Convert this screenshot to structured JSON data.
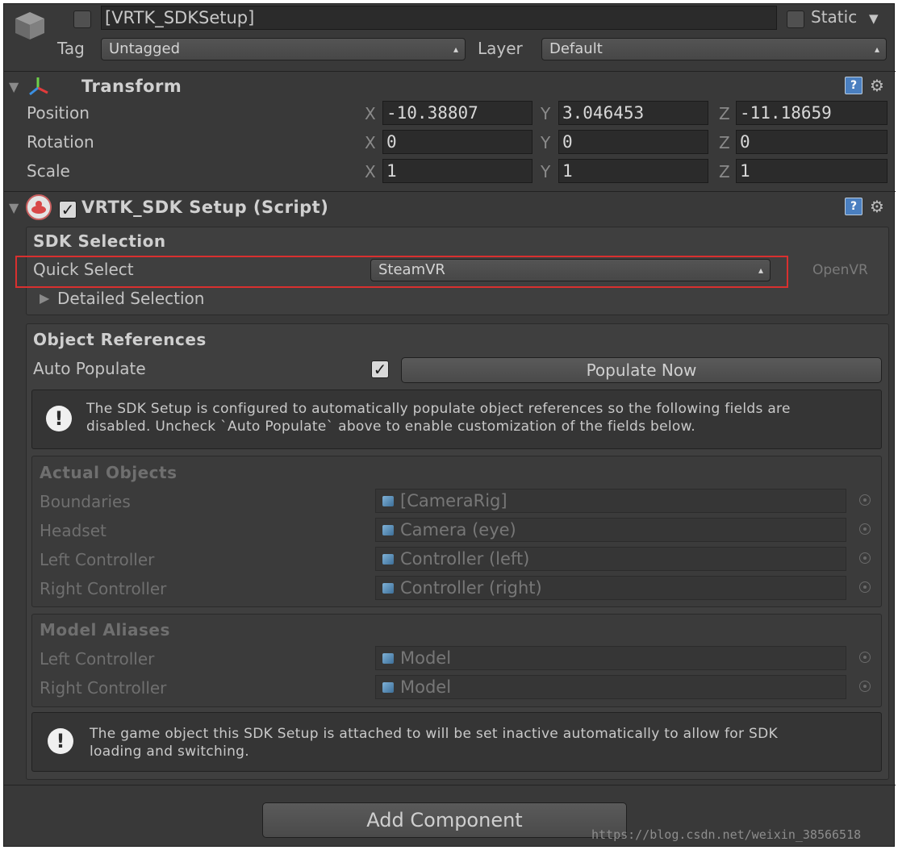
{
  "header": {
    "object_name": "[VRTK_SDKSetup]",
    "active": false,
    "static_label": "Static",
    "static_checked": false,
    "tag_label": "Tag",
    "tag_value": "Untagged",
    "layer_label": "Layer",
    "layer_value": "Default"
  },
  "transform": {
    "title": "Transform",
    "rows": [
      {
        "label": "Position",
        "x": "-10.38807",
        "y": "3.046453",
        "z": "-11.18659"
      },
      {
        "label": "Rotation",
        "x": "0",
        "y": "0",
        "z": "0"
      },
      {
        "label": "Scale",
        "x": "1",
        "y": "1",
        "z": "1"
      }
    ],
    "axis": {
      "x": "X",
      "y": "Y",
      "z": "Z"
    }
  },
  "script": {
    "title": "VRTK_SDK Setup (Script)",
    "enabled": true,
    "sdk_selection": {
      "heading": "SDK Selection",
      "quick_select_label": "Quick Select",
      "quick_select_value": "SteamVR",
      "quick_select_hint": "OpenVR",
      "detailed_label": "Detailed Selection"
    },
    "object_references": {
      "heading": "Object References",
      "auto_populate_label": "Auto Populate",
      "auto_populate_checked": true,
      "populate_button": "Populate Now",
      "help_text_1": "The SDK Setup is configured to automatically populate object references so the following fields are",
      "help_text_2": "disabled. Uncheck `Auto Populate` above to enable customization of the fields below."
    },
    "actual_objects": {
      "heading": "Actual Objects",
      "rows": [
        {
          "label": "Boundaries",
          "value": "[CameraRig]"
        },
        {
          "label": "Headset",
          "value": "Camera (eye)"
        },
        {
          "label": "Left Controller",
          "value": "Controller (left)"
        },
        {
          "label": "Right Controller",
          "value": "Controller (right)"
        }
      ]
    },
    "model_aliases": {
      "heading": "Model Aliases",
      "rows": [
        {
          "label": "Left Controller",
          "value": "Model"
        },
        {
          "label": "Right Controller",
          "value": "Model"
        }
      ]
    },
    "footer_help_1": "The game object this SDK Setup is attached to will be set inactive automatically to allow for SDK",
    "footer_help_2": "loading and switching."
  },
  "add_component_label": "Add Component",
  "watermark": "https://blog.csdn.net/weixin_38566518",
  "highlight_color": "#d9302f"
}
